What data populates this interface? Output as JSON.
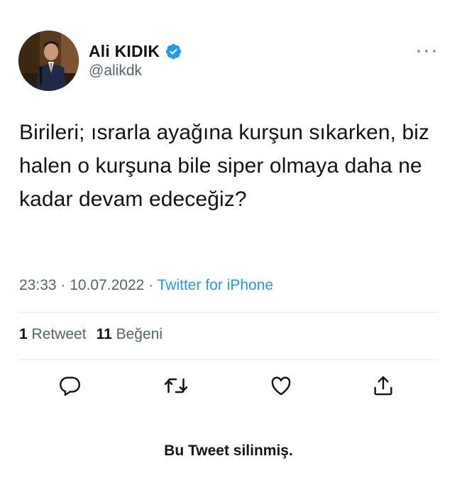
{
  "author": {
    "display_name": "Ali KIDIK",
    "handle": "@alikdk",
    "verified": true,
    "avatar_icon": "profile-photo"
  },
  "tweet": {
    "text": "Birileri; ısrarla ayağına kurşun sıkarken, biz halen o kurşuna bile siper olmaya daha ne kadar devam edeceğiz?"
  },
  "meta": {
    "time": "23:33",
    "separator": " · ",
    "date": "10.07.2022",
    "source": "Twitter for iPhone"
  },
  "stats": {
    "retweet_count": "1",
    "retweet_label": "Retweet",
    "like_count": "11",
    "like_label": "Beğeni"
  },
  "actions": [
    {
      "icon": "reply-icon"
    },
    {
      "icon": "retweet-icon"
    },
    {
      "icon": "like-icon"
    },
    {
      "icon": "share-icon"
    }
  ],
  "notice": {
    "text": "Bu Tweet silinmiş."
  },
  "colors": {
    "text": "#0f1419",
    "muted": "#536471",
    "accent": "#1d9bf0",
    "divider": "#e6ecf0"
  }
}
